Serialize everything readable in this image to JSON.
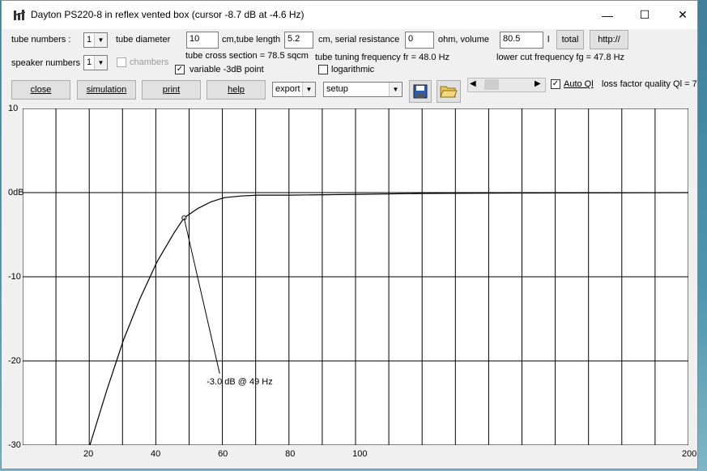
{
  "window": {
    "title": "Dayton PS220-8 in reflex vented box (cursor -8.7 dB at -4.6 Hz)",
    "minimize": "—",
    "maximize": "☐",
    "close": "✕"
  },
  "row1": {
    "tube_numbers_label": "tube numbers :",
    "tube_numbers_value": "1",
    "tube_diameter_label": "tube diameter",
    "tube_diameter_value": "10",
    "tube_length_label": "cm,tube length",
    "tube_length_value": "5.2",
    "serial_resistance_label": "cm, serial resistance",
    "serial_resistance_value": "0",
    "volume_label": "ohm, volume",
    "volume_value": "80.5",
    "volume_unit": "l",
    "total_button": "total",
    "http_button": "http://"
  },
  "row2": {
    "speaker_numbers_label": "speaker numbers :",
    "speaker_numbers_value": "1",
    "chambers_label": "chambers",
    "tube_cross_section": "tube cross section = 78.5 sqcm",
    "tuning_frequency": "tube tuning frequency fr = 48.0 Hz",
    "lower_cut_frequency": "lower cut frequency fg = 47.8 Hz",
    "variable_3db_label": "variable -3dB point",
    "variable_3db_checked": "✓",
    "logarithmic_label": "logarithmic"
  },
  "row3": {
    "close_button": "close",
    "simulation_button": "simulation",
    "print_button": "print",
    "help_button": "help",
    "export_value": "export",
    "setup_value": "setup",
    "auto_ql_label": "Auto Ql",
    "auto_ql_checked": "✓",
    "loss_factor": "loss factor quality Ql = 7"
  },
  "chart_data": {
    "type": "line",
    "title": "",
    "xlabel": "",
    "ylabel": "",
    "xlim": [
      0,
      200
    ],
    "ylim": [
      -30,
      10
    ],
    "y_ticks": [
      "10",
      "0dB",
      "-10",
      "-20",
      "-30"
    ],
    "x_ticks": [
      "20",
      "40",
      "60",
      "80",
      "100",
      "200"
    ],
    "grid": true,
    "series": [
      {
        "x": [
          20,
          25,
          30,
          35,
          40,
          45,
          48,
          52,
          56,
          60,
          65,
          70,
          80,
          100,
          120,
          150,
          200
        ],
        "y": [
          -30,
          -23.5,
          -17.5,
          -12.5,
          -8.2,
          -4.8,
          -3.0,
          -1.9,
          -1.1,
          -0.6,
          -0.4,
          -0.3,
          -0.3,
          -0.2,
          -0.1,
          -0.05,
          0
        ]
      }
    ],
    "annotation": {
      "text": "-3.0 dB @ 49 Hz",
      "x": 48,
      "y": -3.0
    }
  }
}
